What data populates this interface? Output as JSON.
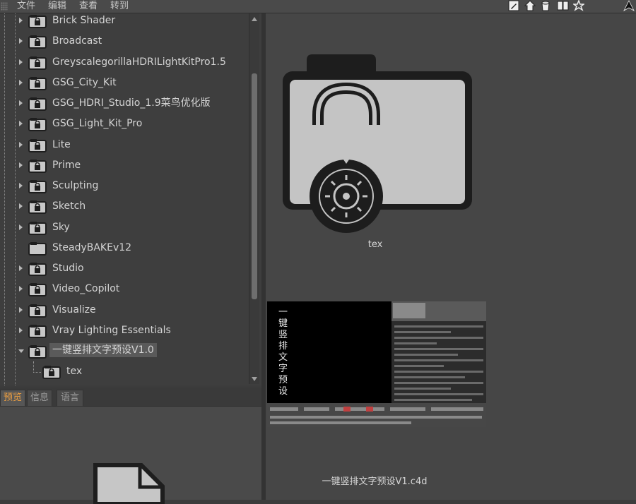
{
  "menu": {
    "items": [
      {
        "label": "文件"
      },
      {
        "label": "编辑"
      },
      {
        "label": "查看"
      },
      {
        "label": "转到"
      }
    ]
  },
  "toolbar": {
    "icons": [
      "pencil-icon",
      "home-icon",
      "bucket-icon",
      "book-icon",
      "star-icon",
      "arrow-up-icon"
    ]
  },
  "tree": {
    "items": [
      {
        "label": "Brick Shader",
        "expandable": true
      },
      {
        "label": "Broadcast",
        "expandable": true
      },
      {
        "label": "GreyscalegorillaHDRILightKitPro1.5",
        "expandable": true
      },
      {
        "label": "GSG_City_Kit",
        "expandable": true
      },
      {
        "label": "GSG_HDRI_Studio_1.9菜鸟优化版",
        "expandable": true
      },
      {
        "label": "GSG_Light_Kit_Pro",
        "expandable": true
      },
      {
        "label": "Lite",
        "expandable": true
      },
      {
        "label": "Prime",
        "expandable": true
      },
      {
        "label": "Sculpting",
        "expandable": true
      },
      {
        "label": "Sketch",
        "expandable": true
      },
      {
        "label": "Sky",
        "expandable": true
      },
      {
        "label": "SteadyBAKEv12",
        "expandable": false
      },
      {
        "label": "Studio",
        "expandable": true
      },
      {
        "label": "Video_Copilot",
        "expandable": true
      },
      {
        "label": "Visualize",
        "expandable": true
      },
      {
        "label": "Vray Lighting Essentials",
        "expandable": true
      },
      {
        "label": "一键竖排文字预设V1.0",
        "expandable": true,
        "open": true,
        "selected": true
      },
      {
        "label": "tex",
        "expandable": false,
        "child": true
      }
    ]
  },
  "tabs": [
    {
      "label": "预览",
      "active": true
    },
    {
      "label": "信息",
      "active": false
    },
    {
      "label": "语言",
      "active": false
    }
  ],
  "content": {
    "folder_caption": "tex",
    "file_caption": "一键竖排文字预设V1.c4d",
    "preview_vertical_text": "一键竖排文字预设"
  },
  "colors": {
    "accent_tab": "#f0a040",
    "panel_bg": "#464646"
  }
}
